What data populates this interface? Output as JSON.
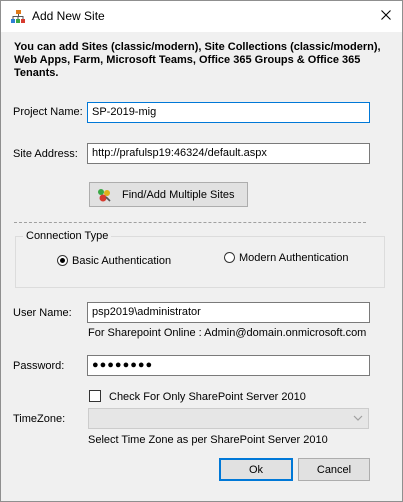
{
  "window": {
    "title": "Add New Site",
    "close_icon": "close-icon",
    "app_icon": "sitemap-icon"
  },
  "intro_text": "You can add Sites (classic/modern), Site Collections (classic/modern), Web Apps, Farm, Microsoft Teams, Office 365 Groups & Office 365 Tenants.",
  "project_name": {
    "label": "Project Name:",
    "value": "SP-2019-mig"
  },
  "site_address": {
    "label": "Site Address:",
    "value": "http://prafulsp19:46324/default.aspx"
  },
  "find_button": {
    "label": "Find/Add Multiple Sites",
    "icon": "sites-icon"
  },
  "connection_type": {
    "title": "Connection Type",
    "options": [
      {
        "label": "Basic Authentication",
        "selected": true
      },
      {
        "label": "Modern Authentication",
        "selected": false
      }
    ]
  },
  "user_name": {
    "label": "User Name:",
    "value": "psp2019\\administrator",
    "hint": "For Sharepoint Online : Admin@domain.onmicrosoft.com"
  },
  "password": {
    "label": "Password:",
    "masked_value": "●●●●●●●●"
  },
  "sp2010_checkbox": {
    "label": "Check For Only SharePoint Server 2010",
    "checked": false
  },
  "timezone": {
    "label": "TimeZone:",
    "value": "",
    "hint": "Select Time Zone as per SharePoint Server 2010",
    "enabled": false
  },
  "buttons": {
    "ok": "Ok",
    "cancel": "Cancel"
  },
  "colors": {
    "focus_border": "#0078d7",
    "window_bg": "#f0f0f0",
    "button_bg": "#e1e1e1"
  }
}
